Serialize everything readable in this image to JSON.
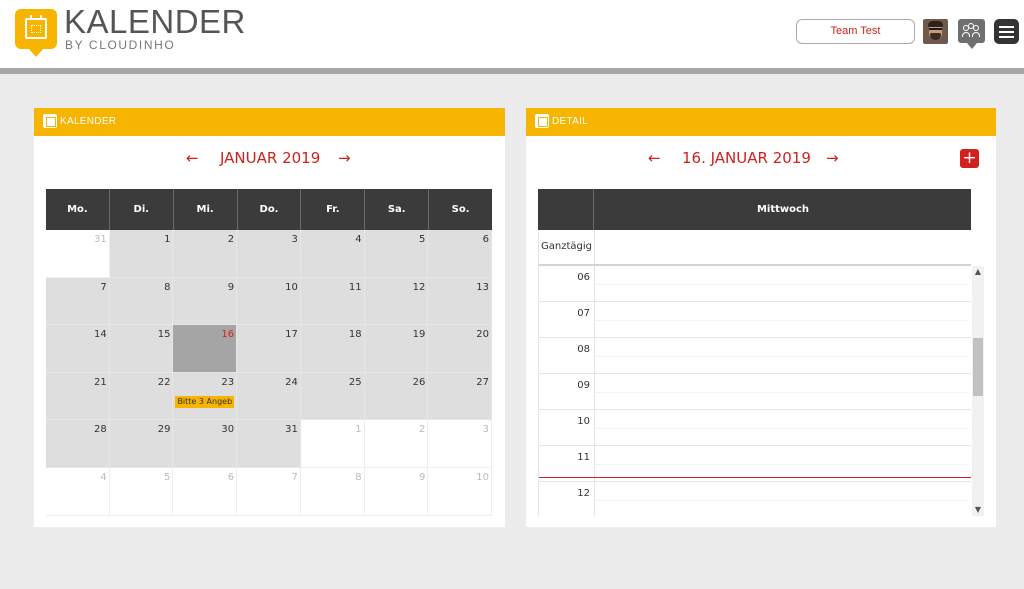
{
  "brand": {
    "title": "KALENDER",
    "subtitle": "BY CLOUDINHO",
    "accent": "#f7b400",
    "highlight": "#d0211c"
  },
  "header": {
    "team_button": "Team Test",
    "avatar_icon": "user-avatar",
    "group_icon": "group-icon",
    "menu_icon": "hamburger-menu-icon"
  },
  "calendar_panel": {
    "title": "KALENDER",
    "month_label": "JANUAR 2019",
    "prev": "←",
    "next": "→",
    "weekdays": [
      "Mo.",
      "Di.",
      "Mi.",
      "Do.",
      "Fr.",
      "Sa.",
      "So."
    ],
    "weeks": [
      [
        "31",
        "1",
        "2",
        "3",
        "4",
        "5",
        "6"
      ],
      [
        "7",
        "8",
        "9",
        "10",
        "11",
        "12",
        "13"
      ],
      [
        "14",
        "15",
        "16",
        "17",
        "18",
        "19",
        "20"
      ],
      [
        "21",
        "22",
        "23",
        "24",
        "25",
        "26",
        "27"
      ],
      [
        "28",
        "29",
        "30",
        "31",
        "1",
        "2",
        "3"
      ],
      [
        "4",
        "5",
        "6",
        "7",
        "8",
        "9",
        "10"
      ]
    ],
    "event_label": "Bitte 3 Angeb"
  },
  "detail_panel": {
    "title": "DETAIL",
    "date_label": "16. JANUAR 2019",
    "prev": "←",
    "next": "→",
    "add": "+",
    "day_name": "Mittwoch",
    "allday_label": "Ganztägig",
    "hours": [
      "06",
      "07",
      "08",
      "09",
      "10",
      "11",
      "12"
    ]
  }
}
